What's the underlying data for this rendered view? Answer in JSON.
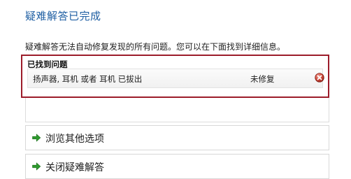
{
  "page": {
    "title": "疑难解答已完成",
    "description": "疑难解答无法自动修复发现的所有问题。您可以在下面找到详细信息。"
  },
  "found_problems": {
    "header": "已找到问题",
    "items": [
      {
        "name": "扬声器, 耳机 或者 耳机 已拔出",
        "status": "未修复",
        "status_icon": "error-icon"
      }
    ]
  },
  "options": [
    {
      "label": "浏览其他选项",
      "icon": "green-arrow-icon"
    },
    {
      "label": "关闭疑难解答",
      "icon": "green-arrow-icon"
    }
  ],
  "colors": {
    "title": "#1f5fa3",
    "highlight_border": "#9c1c2a",
    "arrow": "#2e9a2e",
    "error": "#c0392b"
  }
}
